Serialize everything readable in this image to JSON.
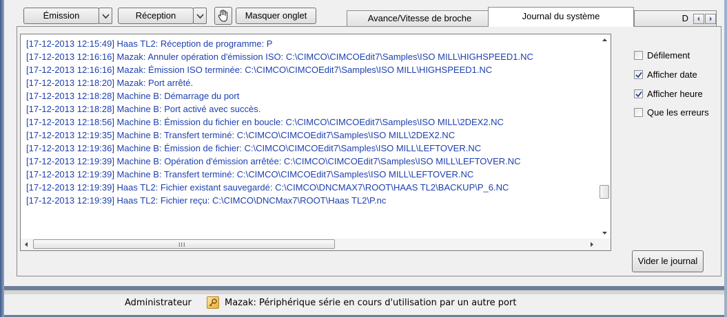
{
  "toolbar": {
    "send_label": "Émission",
    "receive_label": "Réception",
    "hide_tab_label": "Masquer onglet"
  },
  "tabs": [
    {
      "label": "Avance/Vitesse de broche"
    },
    {
      "label": "Journal du système"
    },
    {
      "label": "D"
    }
  ],
  "log": {
    "lines": [
      "[17-12-2013 12:15:49] Haas TL2: Réception de programme: P",
      "[17-12-2013 12:16:16] Mazak: Annuler opération d'émission ISO: C:\\CIMCO\\CIMCOEdit7\\Samples\\ISO MILL\\HIGHSPEED1.NC",
      "[17-12-2013 12:16:16] Mazak: Émission ISO terminée: C:\\CIMCO\\CIMCOEdit7\\Samples\\ISO MILL\\HIGHSPEED1.NC",
      "[17-12-2013 12:18:20] Mazak: Port arrêté.",
      "[17-12-2013 12:18:28] Machine B: Démarrage du port",
      "[17-12-2013 12:18:28] Machine B: Port activé avec succès.",
      "[17-12-2013 12:18:56] Machine B: Émission du fichier en boucle: C:\\CIMCO\\CIMCOEdit7\\Samples\\ISO MILL\\2DEX2.NC",
      "[17-12-2013 12:19:35] Machine B: Transfert terminé: C:\\CIMCO\\CIMCOEdit7\\Samples\\ISO MILL\\2DEX2.NC",
      "[17-12-2013 12:19:36] Machine B: Émission de fichier: C:\\CIMCO\\CIMCOEdit7\\Samples\\ISO MILL\\LEFTOVER.NC",
      "[17-12-2013 12:19:39] Machine B: Opération d'émission arrêtée: C:\\CIMCO\\CIMCOEdit7\\Samples\\ISO MILL\\LEFTOVER.NC",
      "[17-12-2013 12:19:39] Machine B: Transfert terminé: C:\\CIMCO\\CIMCOEdit7\\Samples\\ISO MILL\\LEFTOVER.NC",
      "[17-12-2013 12:19:39] Haas TL2: Fichier existant sauvegardé: C:\\CIMCO\\DNCMAX7\\ROOT\\HAAS TL2\\BACKUP\\P_6.NC",
      "[17-12-2013 12:19:39] Haas TL2: Fichier reçu: C:\\CIMCO\\DNCMax7\\ROOT\\Haas TL2\\P.nc"
    ],
    "hscroll_grip": "III"
  },
  "options": [
    {
      "label": "Défilement",
      "checked": false
    },
    {
      "label": "Afficher date",
      "checked": true
    },
    {
      "label": "Afficher heure",
      "checked": true
    },
    {
      "label": "Que les erreurs",
      "checked": false
    }
  ],
  "clear_log_label": "Vider le journal",
  "status": {
    "user": "Administrateur",
    "message": "Mazak: Périphérique série en cours d'utilisation par un autre port"
  }
}
